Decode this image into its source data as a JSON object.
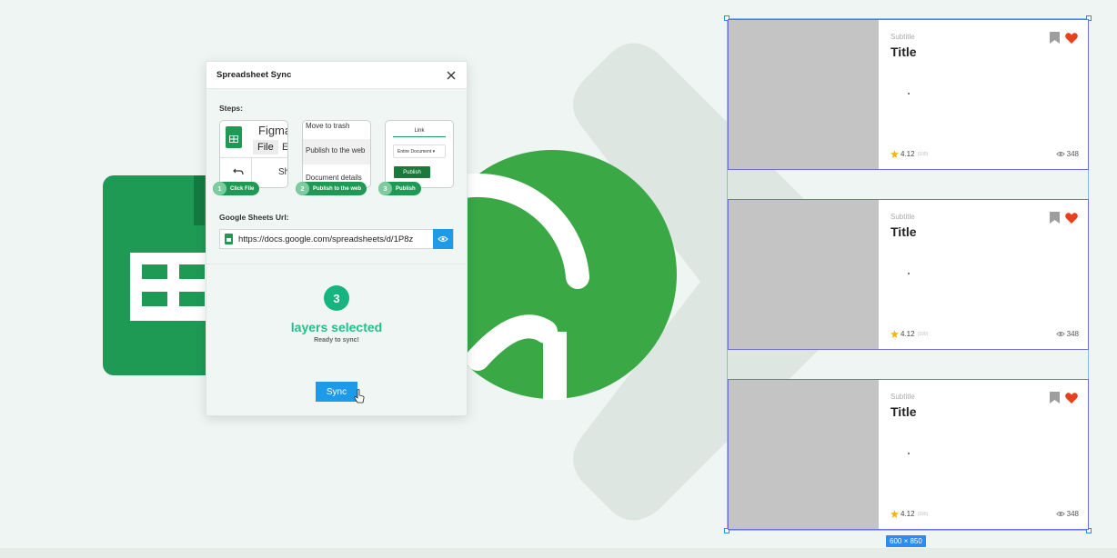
{
  "panel": {
    "title": "Spreadsheet Sync",
    "steps_label": "Steps:",
    "steps": [
      {
        "number": "1",
        "label": "Click File",
        "menu_brand": "Figma",
        "menu_item_1": "File",
        "menu_item_2": "E",
        "menu_item_3": "Sh"
      },
      {
        "number": "2",
        "label": "Publish to the web",
        "menu_items": [
          "Move to trash",
          "Publish to the web",
          "Document details"
        ]
      },
      {
        "number": "3",
        "label": "Publish",
        "tab": "Link",
        "dropdown": "Entire Document",
        "button": "Publish"
      }
    ],
    "url_label": "Google Sheets Url:",
    "url_value": "https://docs.google.com/spreadsheets/d/1P8z",
    "layers_count": "3",
    "layers_text": "layers selected",
    "ready_text": "Ready to sync!",
    "sync_label": "Sync"
  },
  "cards": [
    {
      "subtitle": "Subtitle",
      "title": "Title",
      "rating": "4.12",
      "reviews": "(100)",
      "views": "348"
    },
    {
      "subtitle": "Subtitle",
      "title": "Title",
      "rating": "4.12",
      "reviews": "(100)",
      "views": "348"
    },
    {
      "subtitle": "Subtitle",
      "title": "Title",
      "rating": "4.12",
      "reviews": "(100)",
      "views": "348"
    }
  ],
  "selection": {
    "size_label": "600 × 850"
  },
  "colors": {
    "accent_blue": "#1e9be8",
    "sheets_green": "#1e9a55",
    "teal": "#16b47e",
    "heart_red": "#e8401c",
    "star_yellow": "#f5b400"
  }
}
